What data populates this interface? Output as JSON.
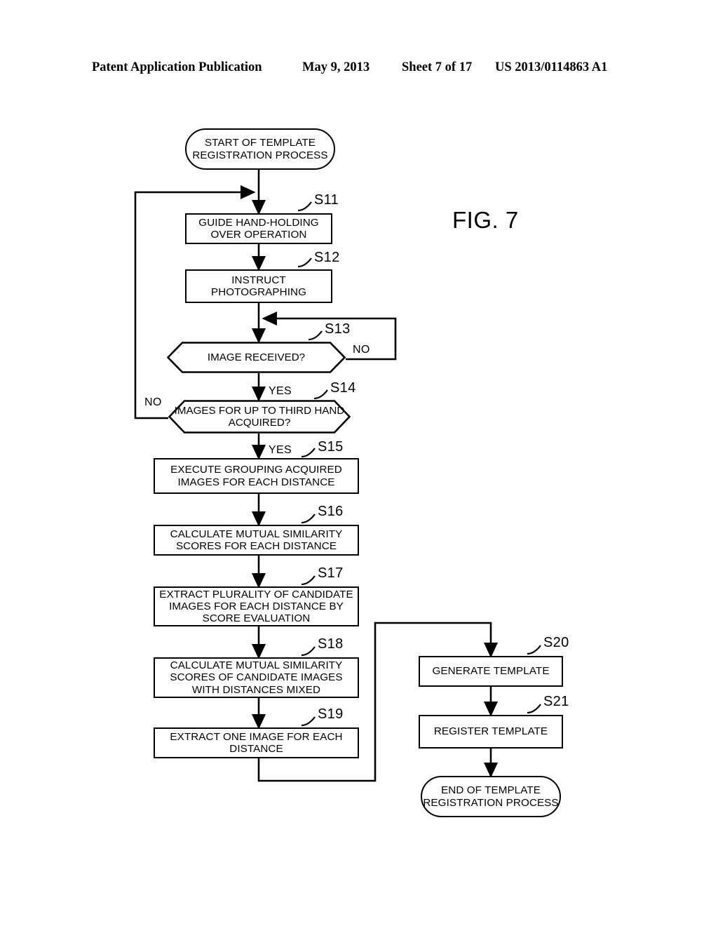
{
  "header": {
    "publication": "Patent Application Publication",
    "date": "May 9, 2013",
    "sheet": "Sheet 7 of 17",
    "number": "US 2013/0114863 A1"
  },
  "figure": {
    "label": "FIG. 7"
  },
  "flowchart": {
    "title": "Template registration process",
    "nodes": [
      {
        "id": "start",
        "type": "terminator",
        "text": "START OF TEMPLATE REGISTRATION PROCESS"
      },
      {
        "id": "s11",
        "type": "process",
        "tag": "S11",
        "text": "GUIDE HAND-HOLDING OVER OPERATION"
      },
      {
        "id": "s12",
        "type": "process",
        "tag": "S12",
        "text": "INSTRUCT PHOTOGRAPHING"
      },
      {
        "id": "s13",
        "type": "decision",
        "tag": "S13",
        "text": "IMAGE RECEIVED?"
      },
      {
        "id": "s14",
        "type": "decision",
        "tag": "S14",
        "text": "IMAGES FOR UP TO THIRD HAND ACQUIRED?"
      },
      {
        "id": "s15",
        "type": "process",
        "tag": "S15",
        "text": "EXECUTE GROUPING ACQUIRED IMAGES FOR EACH DISTANCE"
      },
      {
        "id": "s16",
        "type": "process",
        "tag": "S16",
        "text": "CALCULATE MUTUAL SIMILARITY SCORES FOR EACH DISTANCE"
      },
      {
        "id": "s17",
        "type": "process",
        "tag": "S17",
        "text": "EXTRACT PLURALITY OF CANDIDATE IMAGES FOR EACH DISTANCE BY SCORE EVALUATION"
      },
      {
        "id": "s18",
        "type": "process",
        "tag": "S18",
        "text": "CALCULATE MUTUAL SIMILARITY SCORES OF CANDIDATE IMAGES WITH DISTANCES MIXED"
      },
      {
        "id": "s19",
        "type": "process",
        "tag": "S19",
        "text": "EXTRACT ONE IMAGE FOR EACH DISTANCE"
      },
      {
        "id": "s20",
        "type": "process",
        "tag": "S20",
        "text": "GENERATE TEMPLATE"
      },
      {
        "id": "s21",
        "type": "process",
        "tag": "S21",
        "text": "REGISTER TEMPLATE"
      },
      {
        "id": "end",
        "type": "terminator",
        "text": "END OF TEMPLATE REGISTRATION PROCESS"
      }
    ],
    "edge_labels": {
      "s13_no": "NO",
      "s13_yes": "YES",
      "s14_no": "NO",
      "s14_yes": "YES"
    }
  }
}
